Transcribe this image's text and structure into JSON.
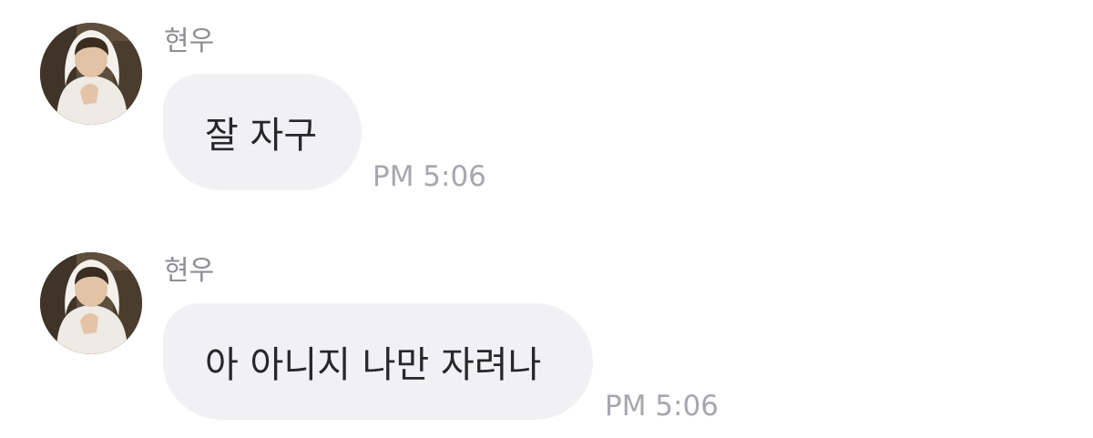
{
  "messages": [
    {
      "sender": "현우",
      "text": "잘 자구",
      "time": "PM 5:06"
    },
    {
      "sender": "현우",
      "text": "아 아니지 나만 자려나",
      "time": "PM 5:06"
    }
  ],
  "colors": {
    "background": "#ffffff",
    "bubble": "#f1f1f4",
    "message_text": "#26262b",
    "sender_text": "#8e8e93",
    "time_text": "#a7a7ad"
  },
  "icons": {
    "avatar": "profile-photo"
  }
}
